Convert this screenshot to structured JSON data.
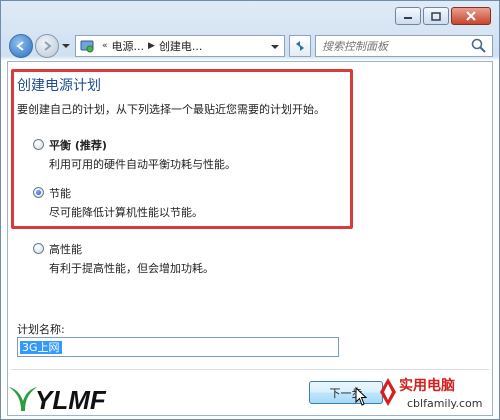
{
  "window": {
    "caption_buttons": [
      "minimize-icon",
      "maximize-icon",
      "close-icon"
    ]
  },
  "navbar": {
    "address": {
      "segment1": "电源...",
      "segment2": "创建电..."
    },
    "search_placeholder": "搜索控制面板"
  },
  "main": {
    "title": "创建电源计划",
    "instruction": "要创建自己的计划，从下列选择一个最贴近您需要的计划开始。",
    "options": [
      {
        "name": "平衡 (推荐)",
        "description": "利用可用的硬件自动平衡功耗与性能。",
        "checked": false
      },
      {
        "name": "节能",
        "description": "尽可能降低计算机性能以节能。",
        "checked": true
      },
      {
        "name": "高性能",
        "description": "有利于提高性能，但会增加功耗。",
        "checked": false
      }
    ],
    "plan_name_label": "计划名称:",
    "plan_name_value": "3G上网",
    "next_button": "下一步"
  },
  "watermarks": {
    "left_logo": "YLMF",
    "site_title": "实用电脑",
    "site_url": "cblfamily.com"
  },
  "colors": {
    "highlight": "#d93a3a",
    "title": "#1d4f8f",
    "selection": "#3399ff"
  }
}
